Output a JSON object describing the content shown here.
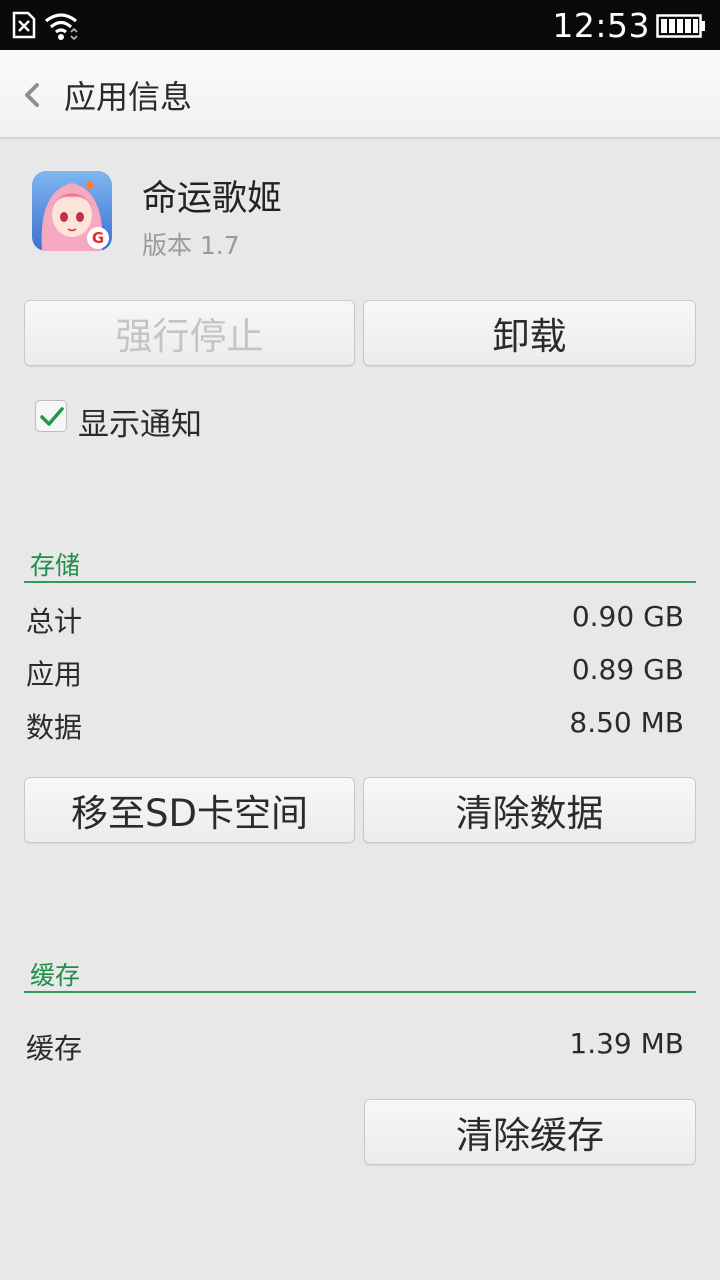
{
  "status_bar": {
    "time": "12:53",
    "icons": [
      "no-sim-icon",
      "wifi-icon",
      "battery-icon"
    ]
  },
  "header": {
    "title": "应用信息",
    "back_icon": "chevron-left-icon"
  },
  "app": {
    "name": "命运歌姬",
    "version": "版本 1.7"
  },
  "actions": {
    "force_stop_label": "强行停止",
    "uninstall_label": "卸载"
  },
  "notification": {
    "label": "显示通知",
    "checked": true
  },
  "storage": {
    "title": "存储",
    "rows": [
      {
        "label": "总计",
        "value": "0.90 GB"
      },
      {
        "label": "应用",
        "value": "0.89 GB"
      },
      {
        "label": "数据",
        "value": "8.50 MB"
      }
    ],
    "move_label": "移至SD卡空间",
    "clear_data_label": "清除数据"
  },
  "cache": {
    "title": "缓存",
    "rows": [
      {
        "label": "缓存",
        "value": "1.39 MB"
      }
    ],
    "clear_cache_label": "清除缓存"
  },
  "colors": {
    "accent_green": "#1f8f47",
    "background": "#e8e8e8",
    "status_bar": "#0a0a0a"
  }
}
